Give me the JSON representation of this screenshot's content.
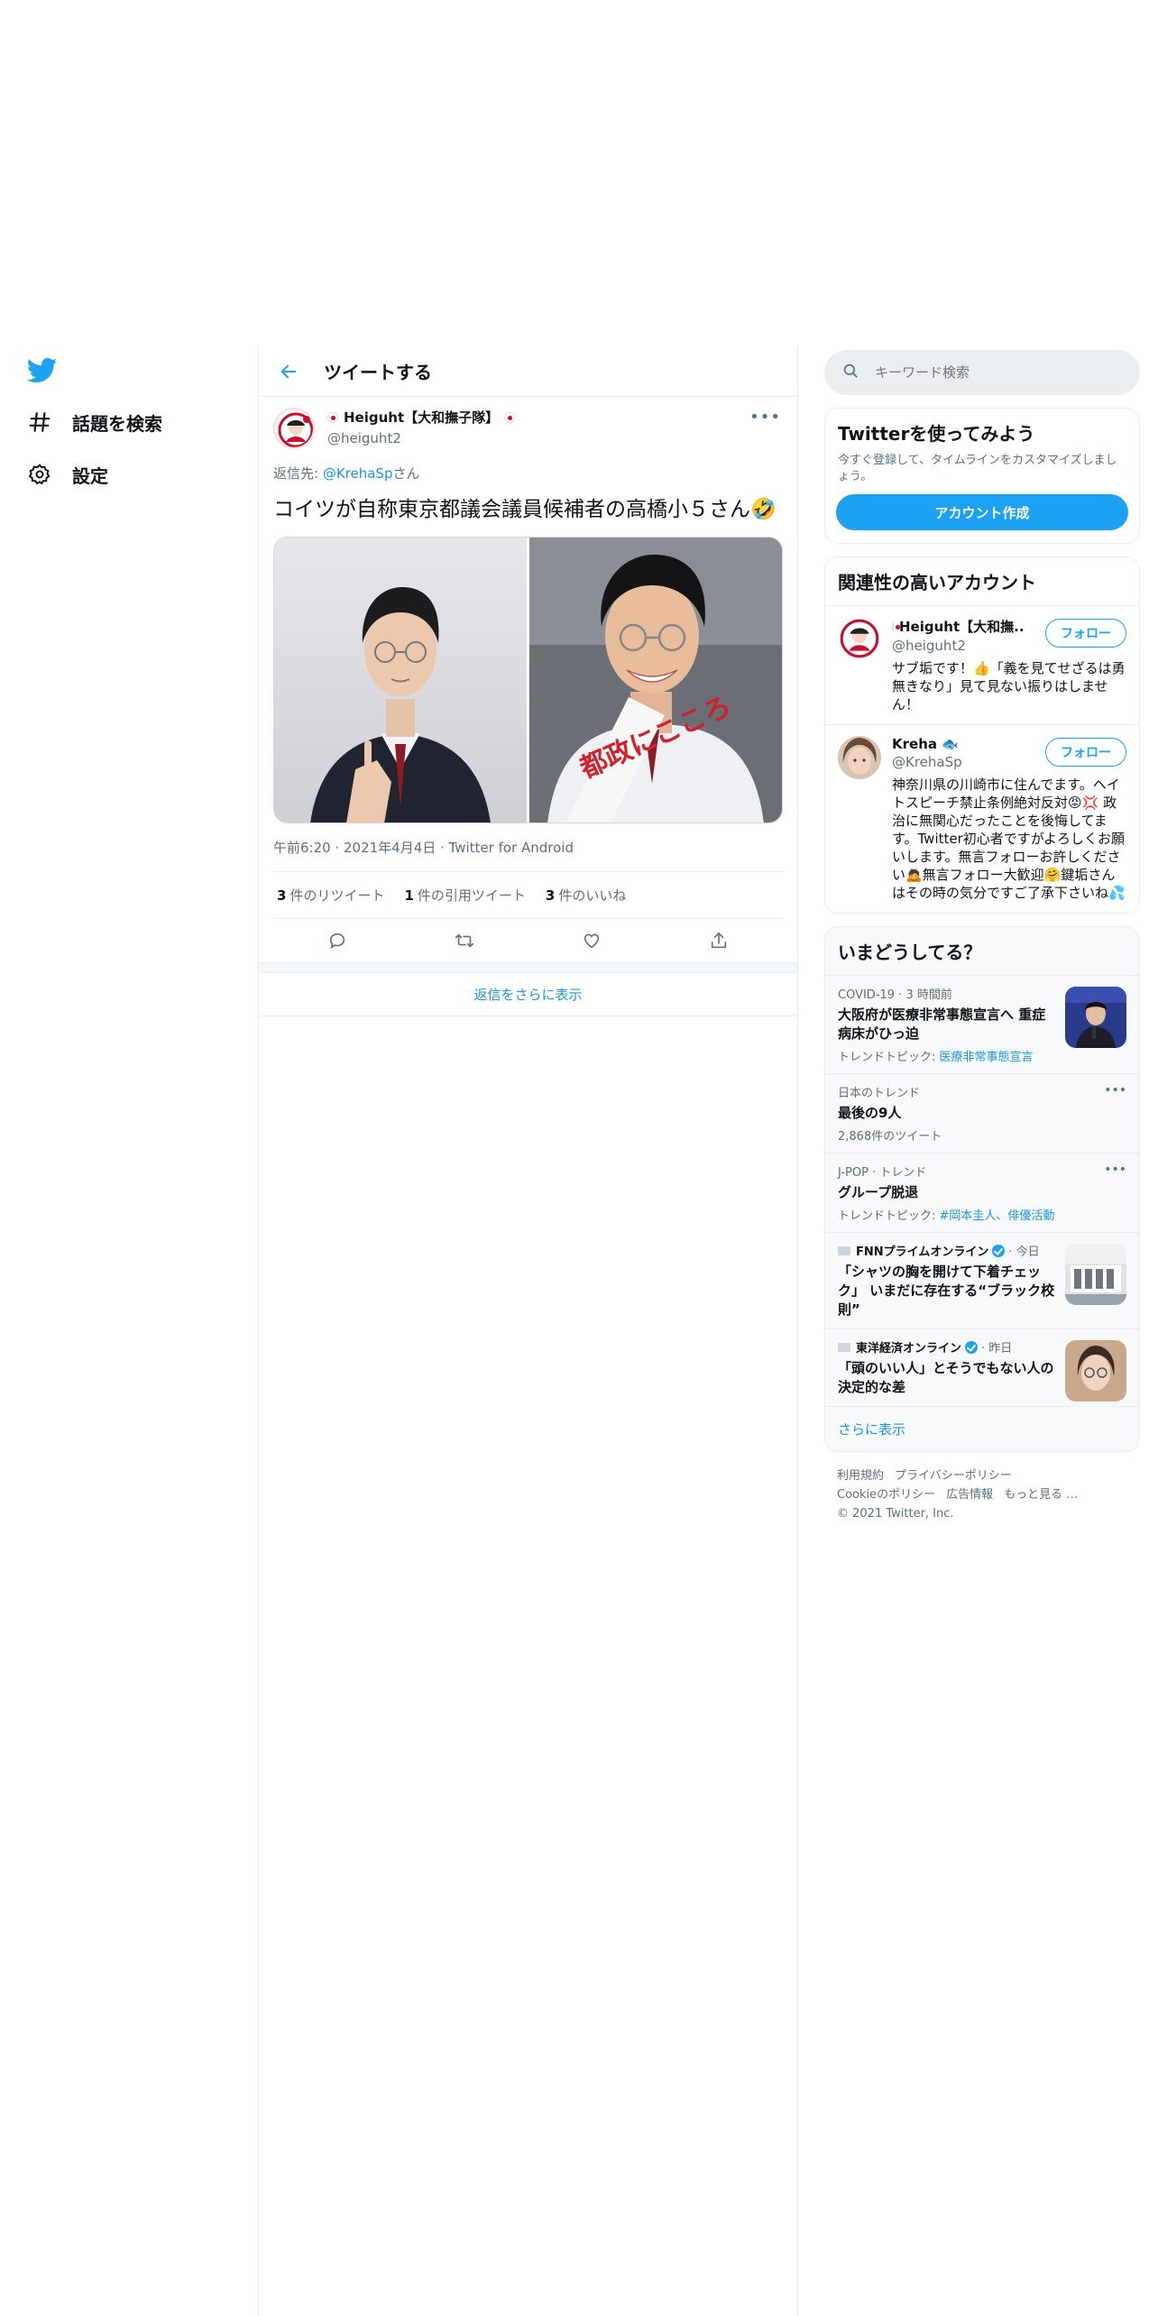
{
  "nav": {
    "logo_icon": "twitter-bird-icon",
    "items": [
      {
        "icon": "hashtag-icon",
        "label": "話題を検索"
      },
      {
        "icon": "gear-icon",
        "label": "設定"
      }
    ]
  },
  "header": {
    "back_icon": "arrow-left-icon",
    "title": "ツイートする"
  },
  "tweet": {
    "display_name": "Heiguht【大和撫子隊】",
    "handle": "@heiguht2",
    "reply_prefix": "返信先: ",
    "reply_handle": "@KrehaSp",
    "reply_suffix": "さん",
    "text": "コイツが自称東京都議会議員候補者の高橋小５さん🤣",
    "meta": "午前6:20 · 2021年4月4日 · Twitter for Android",
    "retweet_count": "3",
    "retweet_label": "件のリツイート",
    "quote_count": "1",
    "quote_label": "件の引用ツイート",
    "like_count": "3",
    "like_label": "件のいいね",
    "photo_sign_text": "都政にこころ"
  },
  "show_more_replies": "返信をさらに表示",
  "search": {
    "placeholder": "キーワード検索"
  },
  "signup": {
    "title": "Twitterを使ってみよう",
    "desc": "今すぐ登録して、タイムラインをカスタマイズしましょう。",
    "button": "アカウント作成"
  },
  "related": {
    "title": "関連性の高いアカウント",
    "accounts": [
      {
        "name": "Heiguht【大和撫...",
        "handle": "@heiguht2",
        "bio": "サブ垢です！👍「義を見てせざるは勇無きなり」見て見ない振りはしません！",
        "follow": "フォロー"
      },
      {
        "name": "Kreha 🐟",
        "handle": "@KrehaSp",
        "bio": "神奈川県の川崎市に住んでます。ヘイトスピーチ禁止条例絶対反対😡💢 政治に無関心だったことを後悔してます。Twitter初心者ですがよろしくお願いします。無言フォローお許しください🙇無言フォロー大歓迎🤗鍵垢さんはその時の気分ですご了承下さいね💦",
        "follow": "フォロー"
      }
    ]
  },
  "trends": {
    "title": "いまどうしてる？",
    "items": [
      {
        "meta": "COVID-19 · 3 時間前",
        "title": "大阪府が医療非常事態宣言へ 重症病床がひっ迫",
        "sub_prefix": "トレンドトピック: ",
        "sub_link": "医療非常事態宣言",
        "has_image": true
      },
      {
        "meta": "日本のトレンド",
        "title": "最後の9人",
        "sub_prefix": "2,868件のツイート",
        "sub_link": "",
        "has_image": false
      },
      {
        "meta": "J-POP · トレンド",
        "title": "グループ脱退",
        "sub_prefix": "トレンドトピック: ",
        "sub_link": "#岡本圭人、俳優活動",
        "has_image": false
      },
      {
        "source": "FNNプライムオンライン",
        "time": " · 今日",
        "title": "「シャツの胸を開けて下着チェック」 いまだに存在する“ブラック校則”",
        "has_image": true
      },
      {
        "source": "東洋経済オンライン",
        "time": " · 昨日",
        "title": "「頭のいい人」とそうでもない人の決定的な差",
        "has_image": true
      }
    ],
    "more": "さらに表示"
  },
  "footer": {
    "links": [
      "利用規約",
      "プライバシーポリシー",
      "Cookieのポリシー",
      "広告情報",
      "もっと見る …"
    ],
    "copyright": "© 2021 Twitter, Inc."
  },
  "colors": {
    "accent": "#1da1f2",
    "link": "#1b95e0",
    "secondary_text": "#5b7083"
  }
}
